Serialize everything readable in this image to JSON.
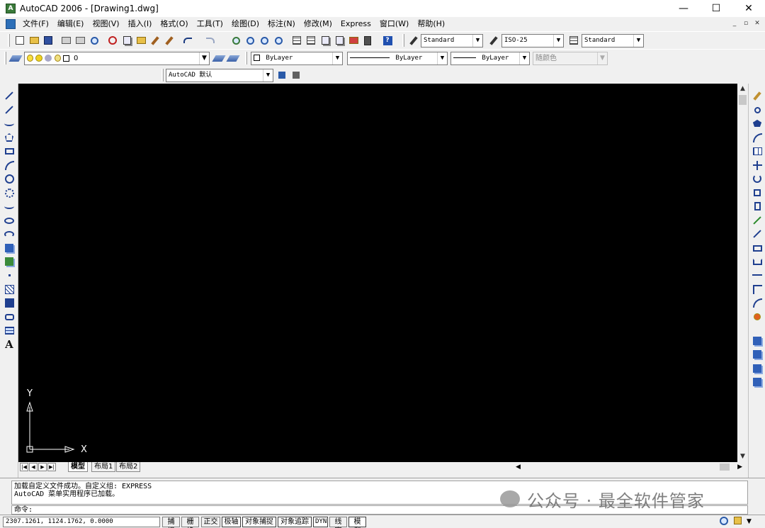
{
  "window": {
    "title": "AutoCAD 2006 - [Drawing1.dwg]",
    "controls": {
      "minimize": "—",
      "maximize": "☐",
      "close": "✕"
    },
    "mdi_controls": [
      "_",
      "▫",
      "✕"
    ]
  },
  "menubar": {
    "items": [
      "文件(F)",
      "编辑(E)",
      "视图(V)",
      "插入(I)",
      "格式(O)",
      "工具(T)",
      "绘图(D)",
      "标注(N)",
      "修改(M)",
      "Express",
      "窗口(W)",
      "帮助(H)"
    ]
  },
  "toolbar": {
    "text_style": "Standard",
    "dim_style": "ISO-25",
    "table_style": "Standard",
    "layer": "0",
    "color": "ByLayer",
    "linetype": "ByLayer",
    "lineweight": "ByLayer",
    "plot_style": "随颜色",
    "workspace": "AutoCAD 默认"
  },
  "canvas": {
    "background": "#000000",
    "ucs_x": "X",
    "ucs_y": "Y"
  },
  "tabs": {
    "model": "模型",
    "layout1": "布局1",
    "layout2": "布局2"
  },
  "command": {
    "history": [
      "加载自定义文件成功。自定义组: EXPRESS",
      "AutoCAD 菜单实用程序已加载。"
    ],
    "prompt": "命令:"
  },
  "watermark": "公众号 · 最全软件管家",
  "statusbar": {
    "coords": "2307.1261, 1124.1762, 0.0000",
    "buttons": [
      "捕捉",
      "栅格",
      "正交",
      "极轴",
      "对象捕捉",
      "对象追踪",
      "DYN",
      "线宽",
      "模型"
    ]
  }
}
